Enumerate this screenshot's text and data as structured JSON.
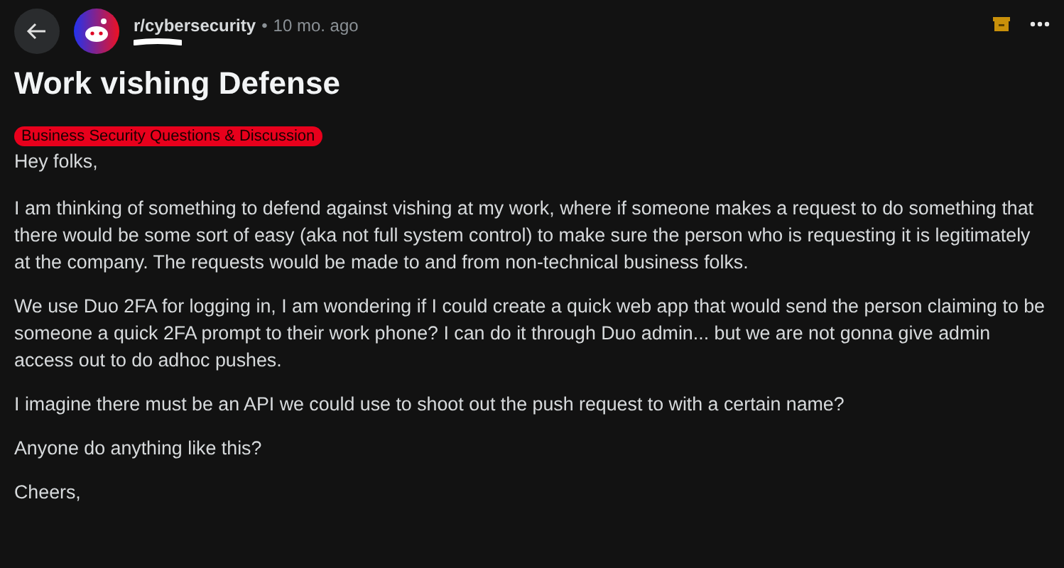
{
  "post": {
    "subreddit": "r/cybersecurity",
    "separator": "•",
    "age": "10 mo. ago",
    "title": "Work vishing Defense",
    "flair": "Business Security Questions & Discussion",
    "paragraphs": [
      "Hey folks,",
      "I am thinking of something to defend against vishing at my work, where if someone makes a request to do something that there would be some sort of easy (aka not full system control) to make sure the person who is requesting it is legitimately at the company. The requests would be made to and from non-technical business folks.",
      "We use Duo 2FA for logging in, I am wondering if I could create a quick web app that would send the person claiming to be someone a quick 2FA prompt to their work phone? I can do it through Duo admin... but we are not gonna give admin access out to do adhoc pushes.",
      "I imagine there must be an API we could use to shoot out the push request to with a certain name?",
      "Anyone do anything like this?",
      "Cheers,"
    ]
  }
}
